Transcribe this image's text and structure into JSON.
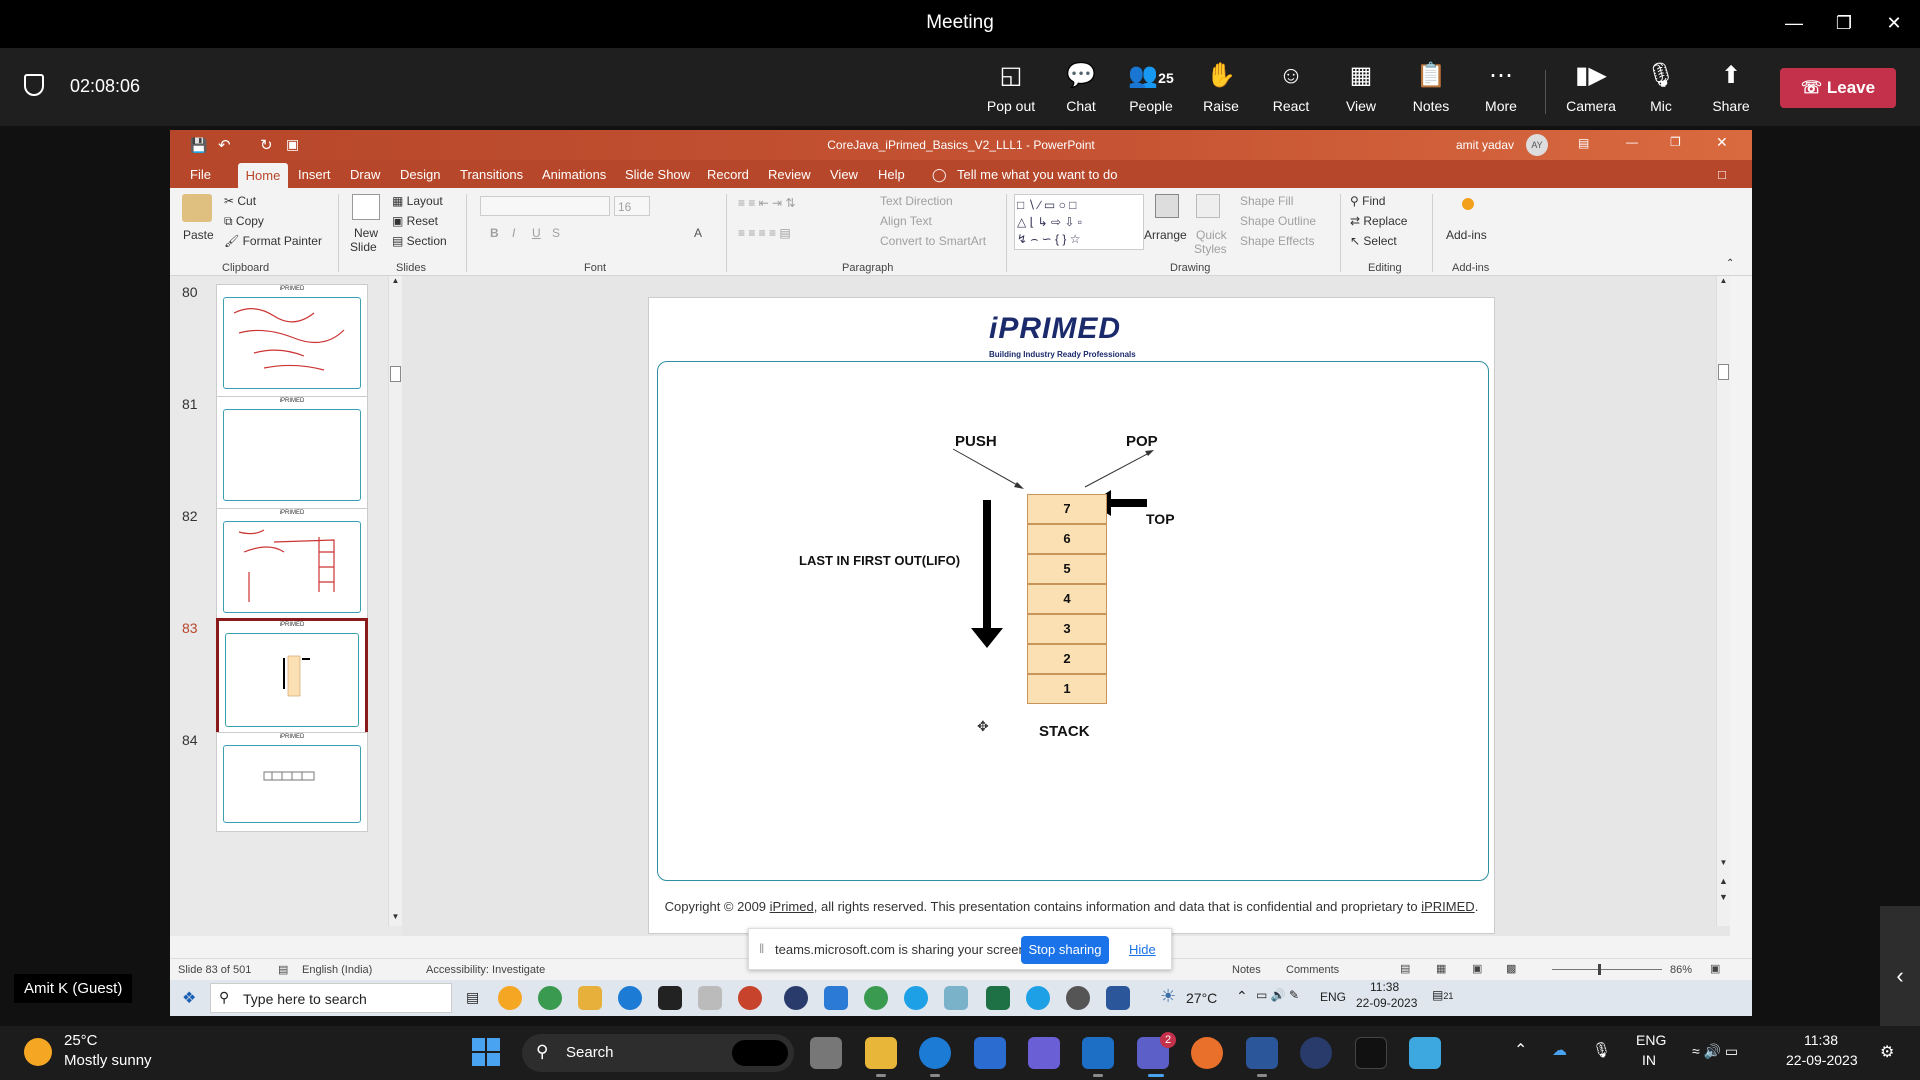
{
  "window": {
    "title": "Meeting"
  },
  "meeting": {
    "duration": "02:08:06",
    "toolbar": [
      {
        "label": "Pop out",
        "icon": "pop-out-icon"
      },
      {
        "label": "Chat",
        "icon": "chat-icon"
      },
      {
        "label": "People",
        "icon": "people-icon",
        "count": "25"
      },
      {
        "label": "Raise",
        "icon": "raise-hand-icon"
      },
      {
        "label": "React",
        "icon": "react-icon"
      },
      {
        "label": "View",
        "icon": "view-icon"
      },
      {
        "label": "Notes",
        "icon": "notes-icon"
      },
      {
        "label": "More",
        "icon": "more-icon"
      },
      {
        "label": "Camera",
        "icon": "camera-icon"
      },
      {
        "label": "Mic",
        "icon": "mic-off-icon"
      },
      {
        "label": "Share",
        "icon": "share-icon"
      }
    ],
    "leave_label": "Leave",
    "presenter_name": "Amit K (Guest)"
  },
  "ppt": {
    "title": "CoreJava_iPrimed_Basics_V2_LLL1 - PowerPoint",
    "user": "amit yadav",
    "user_initials": "AY",
    "menu": [
      "File",
      "Home",
      "Insert",
      "Draw",
      "Design",
      "Transitions",
      "Animations",
      "Slide Show",
      "Record",
      "Review",
      "View",
      "Help"
    ],
    "tell_me": "Tell me what you want to do",
    "ribbon": {
      "paste": "Paste",
      "cut": "Cut",
      "copy": "Copy",
      "format_painter": "Format Painter",
      "clipboard": "Clipboard",
      "new_slide": "New",
      "new_slide2": "Slide",
      "layout": "Layout",
      "reset": "Reset",
      "section": "Section",
      "slides": "Slides",
      "font_size": "16",
      "font": "Font",
      "text_direction": "Text Direction",
      "align_text": "Align Text",
      "convert_smartart": "Convert to SmartArt",
      "paragraph": "Paragraph",
      "arrange": "Arrange",
      "quick_styles": "Quick",
      "quick_styles2": "Styles",
      "shape_fill": "Shape Fill",
      "shape_outline": "Shape Outline",
      "shape_effects": "Shape Effects",
      "drawing": "Drawing",
      "find": "Find",
      "replace": "Replace",
      "select": "Select",
      "editing": "Editing",
      "addins": "Add-ins",
      "addins_group": "Add-ins"
    },
    "thumbnails": [
      {
        "num": "80",
        "selected": false
      },
      {
        "num": "81",
        "selected": false
      },
      {
        "num": "82",
        "selected": false
      },
      {
        "num": "83",
        "selected": true
      },
      {
        "num": "84",
        "selected": false
      }
    ],
    "slide": {
      "logo": "iPRIMED",
      "logo_tagline": "Building Industry Ready Professionals",
      "push": "PUSH",
      "pop": "POP",
      "top": "TOP",
      "lifo": "LAST IN FIRST OUT(LIFO)",
      "stack_label": "STACK",
      "cells": [
        "7",
        "6",
        "5",
        "4",
        "3",
        "2",
        "1"
      ],
      "copyright_pre": "Copyright © 2009 ",
      "copyright_link1": "iPrimed",
      "copyright_mid": ", all rights reserved. This presentation contains information  and data  that is confidential and proprietary to ",
      "copyright_link2": "iPRIMED",
      "copyright_end": "."
    },
    "status": {
      "slide_pos": "Slide 83 of 501",
      "language": "English (India)",
      "accessibility": "Accessibility: Investigate",
      "notes": "Notes",
      "comments": "Comments",
      "zoom": "86%"
    },
    "sharing": {
      "text": "teams.microsoft.com is sharing your screen.",
      "stop": "Stop sharing",
      "hide": "Hide"
    },
    "inner_taskbar": {
      "search": "Type here to search",
      "temp": "27°C",
      "lang": "ENG",
      "time": "11:38",
      "date": "22-09-2023",
      "notif_count": "21"
    }
  },
  "taskbar": {
    "weather_temp": "25°C",
    "weather_desc": "Mostly sunny",
    "search": "Search",
    "lang1": "ENG",
    "lang2": "IN",
    "time": "11:38",
    "date": "22-09-2023",
    "teams_badge": "2"
  }
}
